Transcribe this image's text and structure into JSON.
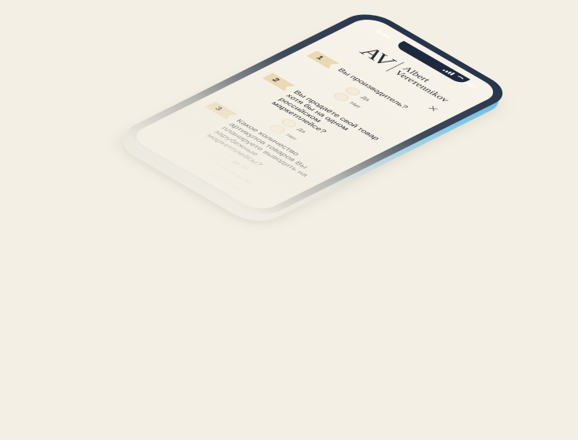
{
  "status_bar": {
    "time": "9:41"
  },
  "brand": {
    "mark": "AV",
    "name_line1": "Albert",
    "name_line2": "Vereтennikov"
  },
  "questions": [
    {
      "number": "1",
      "text": "Вы производитель?",
      "options": [
        "Да",
        "Нет"
      ]
    },
    {
      "number": "2",
      "text": "Вы продаёте свой товар хотя бы на одном российском маркетплейсе?",
      "options": [
        "Да",
        "Нет"
      ]
    },
    {
      "number": "3",
      "text": "Какое количество артикулов товаров Вы планируете выводить на зарубежные маркетплейсы?",
      "options": [
        "до 10",
        "от 10 до 50",
        "от 50 до 100",
        "более 100"
      ]
    }
  ],
  "colors": {
    "background": "#f3efe4",
    "frame_dark": "#26344b",
    "side_accent": "#5db2d9",
    "flag": "#ead9b1"
  }
}
